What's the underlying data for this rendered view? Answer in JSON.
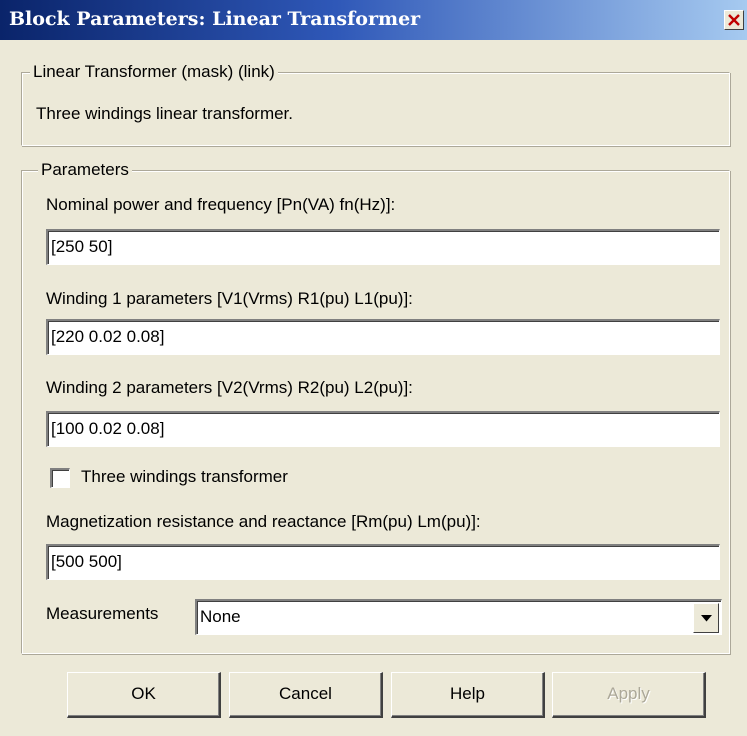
{
  "window": {
    "title": "Block Parameters: Linear Transformer"
  },
  "description_group": {
    "legend": "Linear Transformer (mask) (link)",
    "text": "Three windings linear transformer."
  },
  "parameters_group": {
    "legend": "Parameters",
    "nominal": {
      "label": "Nominal power and frequency [Pn(VA) fn(Hz)]:",
      "value": "[250 50]"
    },
    "winding1": {
      "label": "Winding 1 parameters [V1(Vrms) R1(pu) L1(pu)]:",
      "value": "[220 0.02 0.08]"
    },
    "winding2": {
      "label": "Winding 2 parameters [V2(Vrms) R2(pu) L2(pu)]:",
      "value": "[100 0.02 0.08]"
    },
    "three_windings": {
      "label": "Three windings transformer",
      "checked": false
    },
    "magnetization": {
      "label": "Magnetization resistance and reactance [Rm(pu) Lm(pu)]:",
      "value": "[500 500]"
    },
    "measurements": {
      "label": "Measurements",
      "selected": "None"
    }
  },
  "buttons": {
    "ok": "OK",
    "cancel": "Cancel",
    "help": "Help",
    "apply": "Apply"
  },
  "icons": {
    "close": "close-icon",
    "dropdown": "chevron-down-icon"
  },
  "colors": {
    "titlebar_start": "#0a246a",
    "titlebar_end": "#a6caf0",
    "dialog_bg": "#ece9d8",
    "close_x": "#c00000"
  }
}
